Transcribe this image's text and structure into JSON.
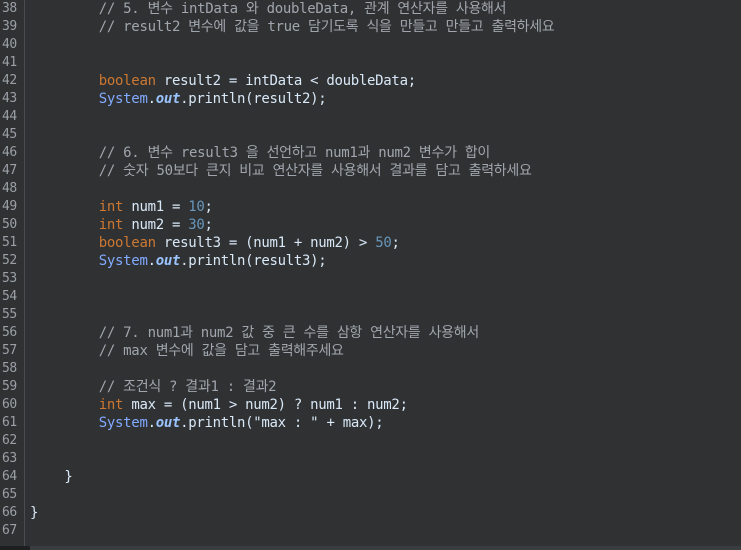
{
  "lines": [
    {
      "n": "38",
      "indent": "        ",
      "tokens": [
        {
          "t": "cm",
          "v": "// 5. 변수 intData 와 doubleData, 관계 연산자를 사용해서"
        }
      ]
    },
    {
      "n": "39",
      "indent": "        ",
      "tokens": [
        {
          "t": "cm",
          "v": "// result2 변수에 값을 true 담기도록 식을 만들고 만들고 출력하세요"
        }
      ]
    },
    {
      "n": "40",
      "indent": "",
      "tokens": []
    },
    {
      "n": "41",
      "indent": "",
      "tokens": []
    },
    {
      "n": "42",
      "indent": "        ",
      "tokens": [
        {
          "t": "kw",
          "v": "boolean"
        },
        {
          "t": "pn",
          "v": " result2 = intData < doubleData;"
        }
      ]
    },
    {
      "n": "43",
      "indent": "        ",
      "tokens": [
        {
          "t": "cls",
          "v": "System"
        },
        {
          "t": "pn",
          "v": "."
        },
        {
          "t": "fld",
          "v": "out"
        },
        {
          "t": "pn",
          "v": ".println(result2);"
        }
      ]
    },
    {
      "n": "44",
      "indent": "",
      "tokens": []
    },
    {
      "n": "45",
      "indent": "",
      "tokens": []
    },
    {
      "n": "46",
      "indent": "        ",
      "tokens": [
        {
          "t": "cm",
          "v": "// 6. 변수 result3 을 선언하고 num1과 num2 변수가 합이"
        }
      ]
    },
    {
      "n": "47",
      "indent": "        ",
      "tokens": [
        {
          "t": "cm",
          "v": "// 숫자 50보다 큰지 비교 연산자를 사용해서 결과를 담고 출력하세요"
        }
      ]
    },
    {
      "n": "48",
      "indent": "",
      "tokens": []
    },
    {
      "n": "49",
      "indent": "        ",
      "tokens": [
        {
          "t": "kw",
          "v": "int"
        },
        {
          "t": "pn",
          "v": " num1 = "
        },
        {
          "t": "num",
          "v": "10"
        },
        {
          "t": "pn",
          "v": ";"
        }
      ]
    },
    {
      "n": "50",
      "indent": "        ",
      "tokens": [
        {
          "t": "kw",
          "v": "int"
        },
        {
          "t": "pn",
          "v": " num2 = "
        },
        {
          "t": "num",
          "v": "30"
        },
        {
          "t": "pn",
          "v": ";"
        }
      ]
    },
    {
      "n": "51",
      "indent": "        ",
      "tokens": [
        {
          "t": "kw",
          "v": "boolean"
        },
        {
          "t": "pn",
          "v": " result3 = (num1 + num2) > "
        },
        {
          "t": "num",
          "v": "50"
        },
        {
          "t": "pn",
          "v": ";"
        }
      ]
    },
    {
      "n": "52",
      "indent": "        ",
      "tokens": [
        {
          "t": "cls",
          "v": "System"
        },
        {
          "t": "pn",
          "v": "."
        },
        {
          "t": "fld",
          "v": "out"
        },
        {
          "t": "pn",
          "v": ".println(result3);"
        }
      ]
    },
    {
      "n": "53",
      "indent": "",
      "tokens": []
    },
    {
      "n": "54",
      "indent": "",
      "tokens": []
    },
    {
      "n": "55",
      "indent": "",
      "tokens": []
    },
    {
      "n": "56",
      "indent": "        ",
      "tokens": [
        {
          "t": "cm",
          "v": "// 7. num1과 num2 값 중 큰 수를 삼항 연산자를 사용해서"
        }
      ]
    },
    {
      "n": "57",
      "indent": "        ",
      "tokens": [
        {
          "t": "cm",
          "v": "// max 변수에 값을 담고 출력해주세요"
        }
      ]
    },
    {
      "n": "58",
      "indent": "",
      "tokens": []
    },
    {
      "n": "59",
      "indent": "        ",
      "tokens": [
        {
          "t": "cm",
          "v": "// 조건식 ? 결과1 : 결과2"
        }
      ]
    },
    {
      "n": "60",
      "indent": "        ",
      "tokens": [
        {
          "t": "kw",
          "v": "int"
        },
        {
          "t": "pn",
          "v": " max = (num1 > num2) ? num1 : num2;"
        }
      ]
    },
    {
      "n": "61",
      "indent": "        ",
      "tokens": [
        {
          "t": "cls",
          "v": "System"
        },
        {
          "t": "pn",
          "v": "."
        },
        {
          "t": "fld",
          "v": "out"
        },
        {
          "t": "pn",
          "v": ".println("
        },
        {
          "t": "str",
          "v": "\"max : \""
        },
        {
          "t": "pn",
          "v": " + max);"
        }
      ]
    },
    {
      "n": "62",
      "indent": "",
      "tokens": []
    },
    {
      "n": "63",
      "indent": "",
      "tokens": []
    },
    {
      "n": "64",
      "indent": "    ",
      "tokens": [
        {
          "t": "pn",
          "v": "}"
        }
      ]
    },
    {
      "n": "65",
      "indent": "",
      "tokens": []
    },
    {
      "n": "66",
      "indent": "",
      "tokens": [
        {
          "t": "pn",
          "v": "}"
        }
      ]
    },
    {
      "n": "67",
      "indent": "",
      "tokens": []
    }
  ],
  "colors": {
    "background": "#2f3133",
    "comment": "#a0a6ad",
    "keyword": "#cc7832",
    "number": "#6897bb",
    "class": "#82aaff",
    "field": "#9bc4ff",
    "text": "#d9e8f7",
    "line_number": "#9aa0a6"
  }
}
